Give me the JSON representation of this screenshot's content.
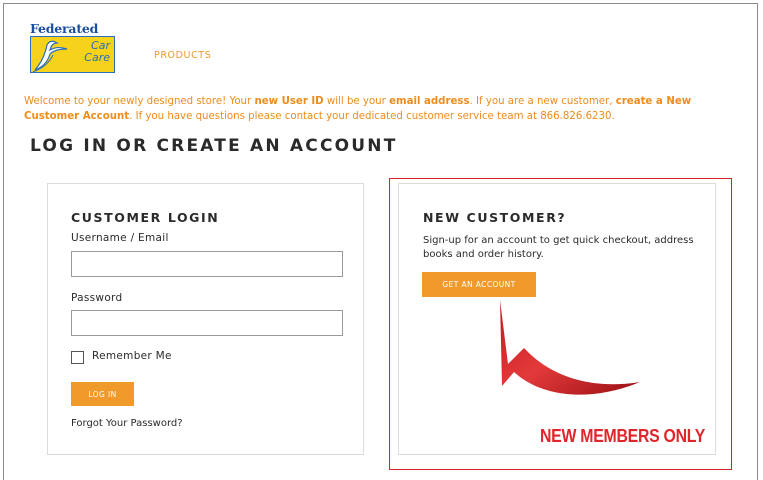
{
  "logo": {
    "brand_top": "Federated",
    "brand_line1": "Car",
    "brand_line2": "Care",
    "icon": "swoosh-bird-logo-icon"
  },
  "nav": {
    "products": "PRODUCTS"
  },
  "welcome": {
    "t1": "Welcome to your newly designed store! Your ",
    "b1": "new User ID",
    "t2": " will be your ",
    "b2": "email address",
    "t3": ". If you are a new customer, ",
    "link": "create a New Customer Account",
    "t4": ". If you have questions please contact your dedicated customer service team at 866.826.6230."
  },
  "page": {
    "heading": "LOG IN OR CREATE AN ACCOUNT"
  },
  "login": {
    "title": "CUSTOMER LOGIN",
    "username_label": "Username / Email",
    "username_value": "",
    "password_label": "Password",
    "password_value": "",
    "remember_label": "Remember Me",
    "button": "LOG IN",
    "forgot": "Forgot Your Password?"
  },
  "new_customer": {
    "title": "NEW CUSTOMER?",
    "description": "Sign-up for an account to get quick checkout, address books and order history.",
    "button": "GET AN ACCOUNT"
  },
  "annotation": {
    "text": "NEW MEMBERS ONLY",
    "color": "#e0262c",
    "arrow_icon": "curved-arrow-icon"
  },
  "colors": {
    "accent": "#ef9a2b",
    "highlight": "#d8232a"
  }
}
